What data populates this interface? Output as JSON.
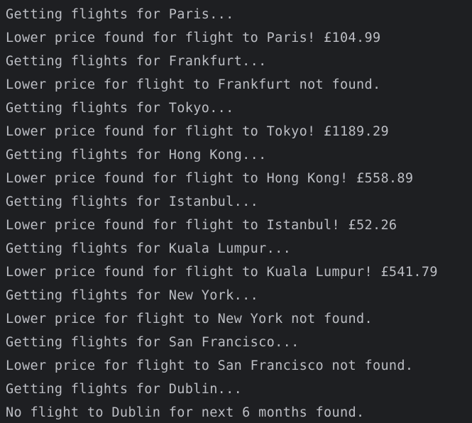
{
  "console": {
    "lines": [
      "Getting flights for Paris...",
      "Lower price found for flight to Paris! £104.99",
      "Getting flights for Frankfurt...",
      "Lower price for flight to Frankfurt not found.",
      "Getting flights for Tokyo...",
      "Lower price found for flight to Tokyo! £1189.29",
      "Getting flights for Hong Kong...",
      "Lower price found for flight to Hong Kong! £558.89",
      "Getting flights for Istanbul...",
      "Lower price found for flight to Istanbul! £52.26",
      "Getting flights for Kuala Lumpur...",
      "Lower price found for flight to Kuala Lumpur! £541.79",
      "Getting flights for New York...",
      "Lower price for flight to New York not found.",
      "Getting flights for San Francisco...",
      "Lower price for flight to San Francisco not found.",
      "Getting flights for Dublin...",
      "No flight to Dublin for next 6 months found."
    ]
  },
  "colors": {
    "background": "#1e1f22",
    "text": "#bcbec4"
  }
}
